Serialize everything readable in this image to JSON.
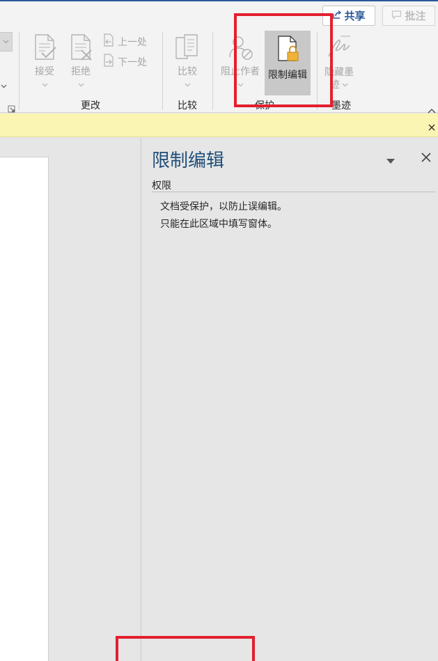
{
  "header": {
    "share_label": "共享",
    "comment_label": "批注",
    "share_icon": "share-arrow-icon",
    "comment_icon": "comment-bubble-icon"
  },
  "ribbon": {
    "changes": {
      "accept_label": "接受",
      "reject_label": "拒绝",
      "previous_label": "上一处",
      "next_label": "下一处",
      "group_label": "更改"
    },
    "compare": {
      "compare_label": "比较",
      "group_label": "比较"
    },
    "protect": {
      "block_authors_label": "阻止作者",
      "restrict_editing_label": "限制编辑",
      "group_label": "保护"
    },
    "ink": {
      "hide_ink_label_line1": "隐藏墨",
      "hide_ink_label_line2": "迹",
      "group_label": "墨迹"
    }
  },
  "pane": {
    "title": "限制编辑",
    "section": "权限",
    "lines": [
      "文档受保护，以防止误编辑。",
      "只能在此区域中填写窗体。"
    ]
  },
  "colors": {
    "accent": "#2b579a",
    "pane_title": "#1f4e79",
    "info_bar": "#fbf5b4",
    "highlight": "#e3202e",
    "active_button": "#c8c8c8"
  }
}
